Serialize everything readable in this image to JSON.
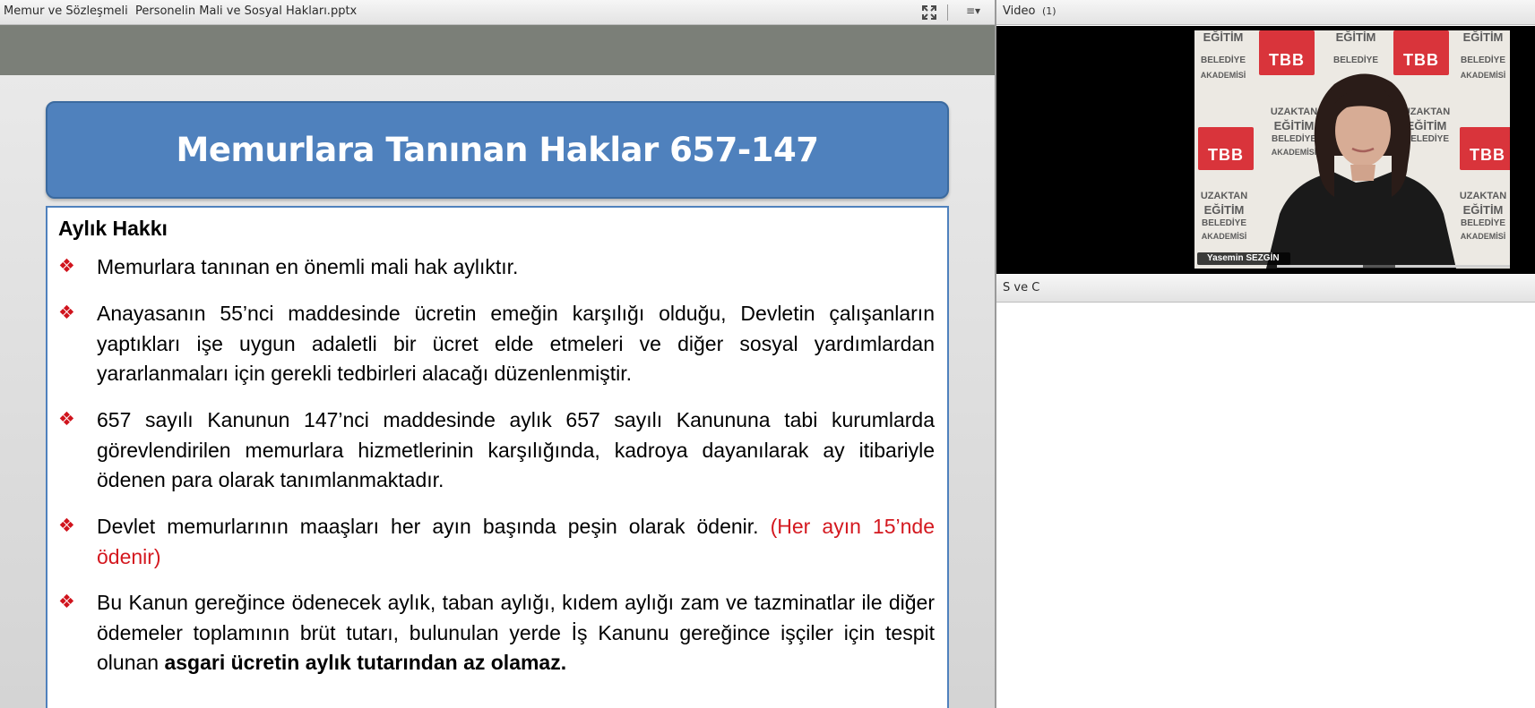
{
  "presentation_pane": {
    "file_title": "Memur ve Sözleşmeli  Personelin Mali ve Sosyal Hakları.pptx",
    "fullscreen_icon": "fullscreen-icon",
    "menu_icon": "hamburger-menu-icon",
    "menu_glyph": "≡▾"
  },
  "slide": {
    "title": "Memurlara Tanınan Haklar 657-147",
    "section_title": "Aylık Hakkı",
    "bullet_marker": "❖",
    "bullets": [
      {
        "text": "Memurlara tanınan en önemli mali hak aylıktır."
      },
      {
        "text": "Anayasanın 55’nci maddesinde ücretin emeğin karşılığı olduğu, Devletin çalışanların yaptıkları işe uygun adaletli bir ücret elde etmeleri ve diğer sosyal yardımlardan yararlanmaları için gerekli tedbirleri alacağı düzenlenmiştir."
      },
      {
        "text": "657 sayılı Kanunun 147’nci maddesinde aylık 657 sayılı Kanununa tabi kurumlarda görevlendirilen memurlara hizmetlerinin karşılığında, kadroya dayanılarak ay itibariyle ödenen para olarak tanımlanmaktadır."
      },
      {
        "text": "Devlet memurlarının maaşları her ayın başında peşin olarak ödenir. ",
        "highlight": "(Her ayın 15’nde ödenir)"
      },
      {
        "text": "Bu Kanun gereğince ödenecek aylık, taban aylığı, kıdem aylığı zam ve tazminatlar ile diğer ödemeler toplamının brüt tutarı, bulunulan yerde İş Kanunu gereğince işçiler için tespit olunan ",
        "bold": "asgari ücretin aylık tutarından az olamaz."
      }
    ],
    "colors": {
      "title_bg": "#4f81bd",
      "bullet_marker": "#d0141d",
      "highlight": "#d4181f"
    }
  },
  "video_pane": {
    "label": "Video",
    "count": "(1)",
    "presenter_name": "Yasemin SEZGİN",
    "backdrop": {
      "line1": "UZAKTAN",
      "line2": "EĞİTİM",
      "line3": "BELEDİYE",
      "line4": "AKADEMİSİ",
      "logo": "TBB"
    }
  },
  "chat_pane": {
    "label": "S ve C"
  }
}
